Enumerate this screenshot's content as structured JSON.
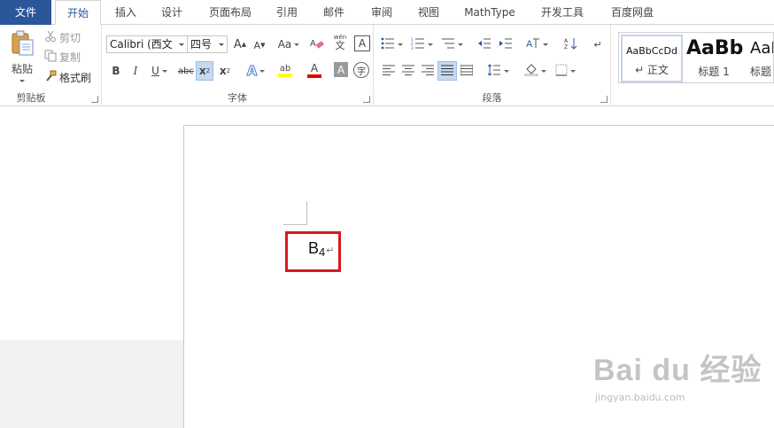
{
  "tabs": [
    {
      "label": "文件"
    },
    {
      "label": "开始"
    },
    {
      "label": "插入"
    },
    {
      "label": "设计"
    },
    {
      "label": "页面布局"
    },
    {
      "label": "引用"
    },
    {
      "label": "邮件"
    },
    {
      "label": "审阅"
    },
    {
      "label": "视图"
    },
    {
      "label": "MathType"
    },
    {
      "label": "开发工具"
    },
    {
      "label": "百度网盘"
    }
  ],
  "clipboard": {
    "paste_label": "粘贴",
    "cut_label": "剪切",
    "copy_label": "复制",
    "format_painter_label": "格式刷",
    "group_label": "剪贴板"
  },
  "font": {
    "font_name": "Calibri (西文",
    "font_size": "四号",
    "grow_label": "A",
    "shrink_label": "A",
    "case_label": "Aa",
    "phonetic_label": "wén",
    "border_char_label": "A",
    "bold": "B",
    "italic": "I",
    "underline": "U",
    "strike": "abc",
    "subscript": "x",
    "superscript": "x",
    "text_effect": "A",
    "highlight": "ab",
    "font_color": "A",
    "char_shading": "A",
    "enclose": "字",
    "group_label": "字体"
  },
  "paragraph": {
    "group_label": "段落"
  },
  "styles": {
    "items": [
      {
        "preview": "AaBbCcDd",
        "name": "↵ 正文"
      },
      {
        "preview": "AaBb",
        "name": "标题 1"
      },
      {
        "preview": "AaI",
        "name": "标题"
      }
    ]
  },
  "document": {
    "text_main": "B",
    "text_sub": "4",
    "para_mark": "↵"
  },
  "watermark": {
    "main": "Bai du 经验",
    "sub": "jingyan.baidu.com"
  },
  "colors": {
    "file_tab": "#2b579a",
    "highlight_box": "#d9191c",
    "highlight_yellow": "#ffff00",
    "font_red": "#e00000"
  }
}
